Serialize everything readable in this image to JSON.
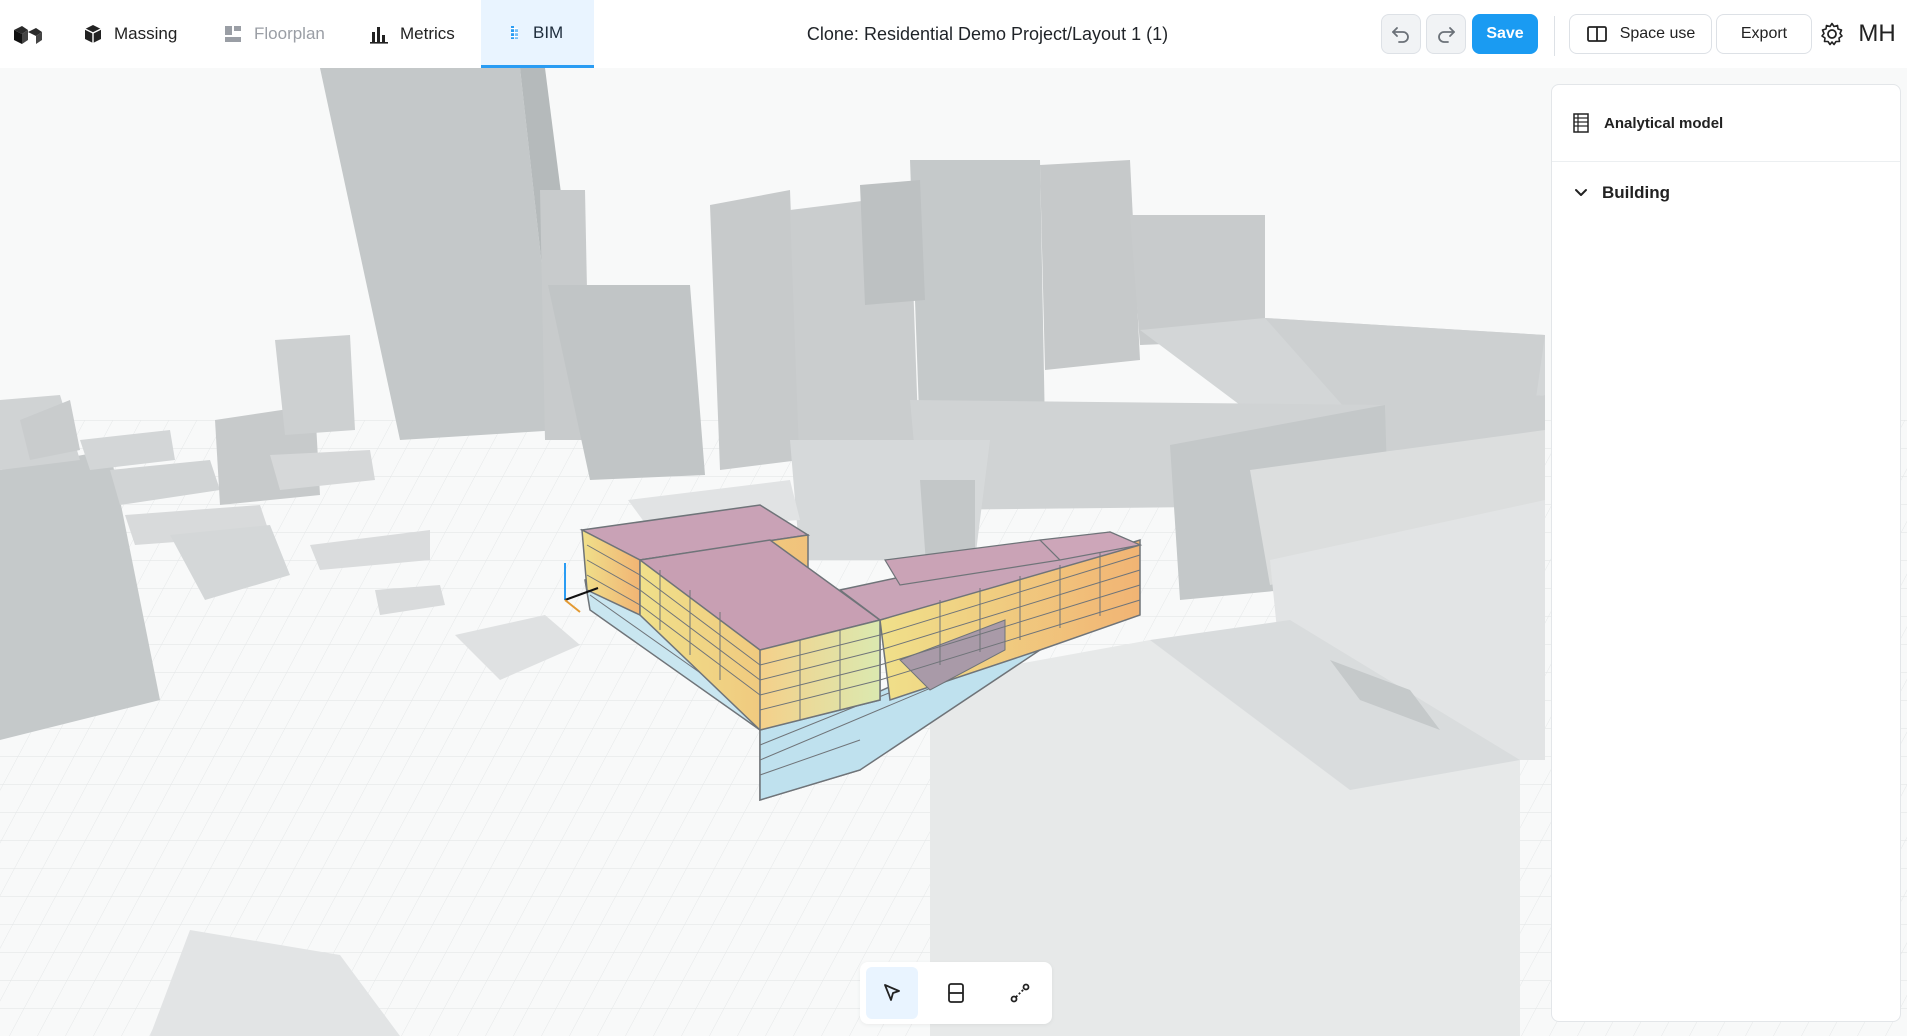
{
  "nav": {
    "tabs": [
      {
        "label": "Massing",
        "state": "normal"
      },
      {
        "label": "Floorplan",
        "state": "disabled"
      },
      {
        "label": "Metrics",
        "state": "normal"
      },
      {
        "label": "BIM",
        "state": "active"
      }
    ]
  },
  "header": {
    "title": "Clone: Residential Demo Project/Layout 1 (1)",
    "save_label": "Save",
    "space_use_label": "Space use",
    "export_label": "Export",
    "avatar_initials": "MH"
  },
  "panel": {
    "heading": "Analytical model",
    "tree_item": "Building"
  },
  "toolbar": {
    "tools": [
      "select-tool",
      "section-tool",
      "measure-tool"
    ],
    "active_tool": "select-tool"
  },
  "colors": {
    "accent": "#1a9bf2",
    "active_tab_bg": "#e9f4ff",
    "context_buildings": "#c7cbcc",
    "ground": "#f7f8f8"
  }
}
